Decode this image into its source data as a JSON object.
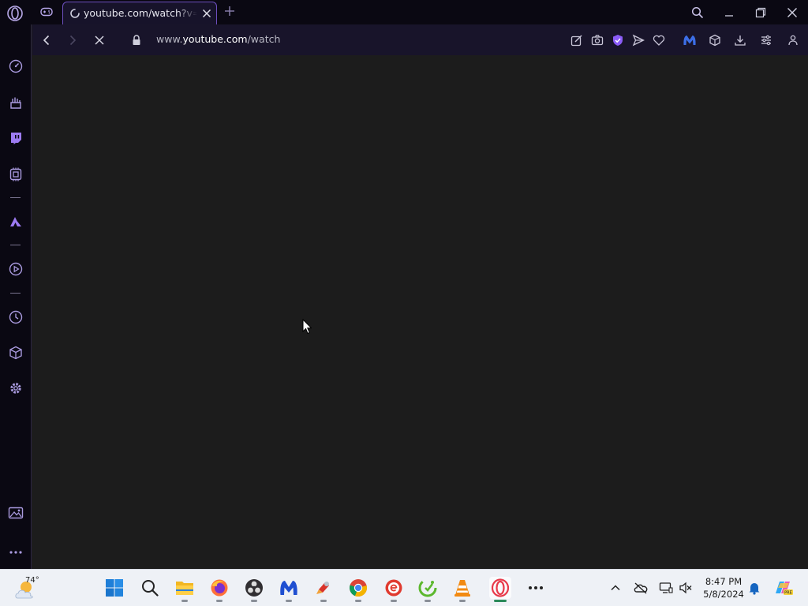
{
  "browser": {
    "tab": {
      "title": "youtube.com/watch?v=MJO"
    },
    "address": {
      "prefix": "www.",
      "host": "youtube.com",
      "path": "/watch"
    }
  },
  "sidebar": {
    "items": [
      {
        "icon": "speedometer-icon"
      },
      {
        "icon": "gamepad-hand-icon"
      },
      {
        "icon": "twitch-icon"
      },
      {
        "icon": "control-panel-icon"
      },
      {
        "icon": "messenger-icon"
      },
      {
        "icon": "player-icon"
      },
      {
        "icon": "history-icon"
      },
      {
        "icon": "extensions-icon"
      },
      {
        "icon": "settings-icon"
      },
      {
        "icon": "wallpaper-icon"
      },
      {
        "icon": "more-icon"
      }
    ]
  },
  "taskbar": {
    "weather": {
      "temp": "74°"
    },
    "apps": [
      "start",
      "search",
      "file-explorer",
      "firefox",
      "obs",
      "malwarebytes",
      "ccleaner",
      "chrome",
      "app-e",
      "app-green",
      "vlc",
      "opera-gx",
      "more"
    ],
    "clock": {
      "time": "8:47 PM",
      "date": "5/8/2024"
    }
  },
  "colors": {
    "accent": "#8b5cf6",
    "background": "#1c1c1c",
    "frame": "#0a0812"
  }
}
